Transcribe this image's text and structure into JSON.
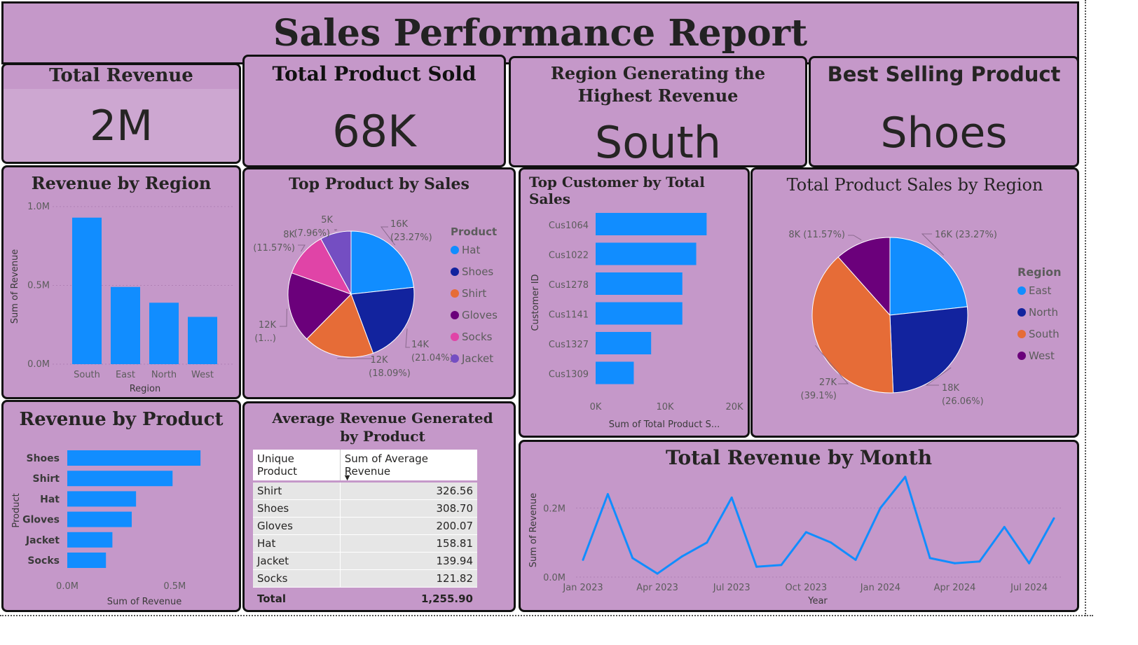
{
  "report_title": "Sales Performance Report",
  "kpis": [
    {
      "label": "Total Revenue",
      "value": "2M"
    },
    {
      "label": "Total Product Sold",
      "value": "68K"
    },
    {
      "label": "Region Generating the Highest Revenue",
      "value": "South"
    },
    {
      "label": "Best Selling Product",
      "value": "Shoes"
    }
  ],
  "colors": {
    "panel_bg": "#c598c9",
    "bar": "#118dff",
    "east": "#118dff",
    "north": "#12239e",
    "south": "#e66c37",
    "west": "#6b007b",
    "socks": "#e044a7",
    "jacket": "#744ec2"
  },
  "chart_data": [
    {
      "id": "revenue_by_region",
      "type": "bar",
      "title": "Revenue by Region",
      "xlabel": "Region",
      "ylabel": "Sum of Revenue",
      "categories": [
        "South",
        "East",
        "North",
        "West"
      ],
      "values": [
        0.93,
        0.49,
        0.39,
        0.3
      ],
      "ylim": [
        0,
        1.0
      ],
      "ticks": [
        "0.0M",
        "0.5M",
        "1.0M"
      ],
      "tick_values": [
        0,
        0.5,
        1.0
      ],
      "grid": true
    },
    {
      "id": "top_product_by_sales",
      "type": "pie",
      "title": "Top Product by Sales",
      "legend_title": "Product",
      "legend_position": "right",
      "slices": [
        {
          "name": "Hat",
          "value": 23.27,
          "label_a": "16K",
          "label_b": "(23.27%)",
          "color": "#118dff"
        },
        {
          "name": "Shoes",
          "value": 21.04,
          "label_a": "14K",
          "label_b": "(21.04%)",
          "color": "#12239e"
        },
        {
          "name": "Shirt",
          "value": 18.09,
          "label_a": "12K",
          "label_b": "(18.09%)",
          "color": "#e66c37"
        },
        {
          "name": "Gloves",
          "value": 18.07,
          "label_a": "12K",
          "label_b": "(1...)",
          "color": "#6b007b"
        },
        {
          "name": "Socks",
          "value": 11.57,
          "label_a": "8K",
          "label_b": "(11.57%)",
          "color": "#e044a7"
        },
        {
          "name": "Jacket",
          "value": 7.96,
          "label_a": "5K",
          "label_b": "(7.96%)",
          "color": "#744ec2"
        }
      ]
    },
    {
      "id": "top_customer_by_total_sales",
      "type": "bar",
      "orientation": "horizontal",
      "title": "Top Customer by Total Sales",
      "xlabel": "Sum of Total Product S...",
      "ylabel": "Customer ID",
      "categories": [
        "Cus1064",
        "Cus1022",
        "Cus1278",
        "Cus1141",
        "Cus1327",
        "Cus1309"
      ],
      "values": [
        16000,
        14500,
        12500,
        12500,
        8000,
        5500
      ],
      "xlim": [
        0,
        20000
      ],
      "ticks": [
        "0K",
        "10K",
        "20K"
      ],
      "tick_values": [
        0,
        10000,
        20000
      ]
    },
    {
      "id": "total_product_sales_by_region",
      "type": "pie",
      "title": "Total Product Sales by Region",
      "legend_title": "Region",
      "legend_position": "right",
      "slices": [
        {
          "name": "East",
          "value": 23.27,
          "label_a": "16K (23.27%)",
          "label_b": "",
          "color": "#118dff"
        },
        {
          "name": "North",
          "value": 26.06,
          "label_a": "18K",
          "label_b": "(26.06%)",
          "color": "#12239e"
        },
        {
          "name": "South",
          "value": 39.1,
          "label_a": "27K",
          "label_b": "(39.1%)",
          "color": "#e66c37"
        },
        {
          "name": "West",
          "value": 11.57,
          "label_a": "8K (11.57%)",
          "label_b": "",
          "color": "#6b007b"
        }
      ]
    },
    {
      "id": "revenue_by_product",
      "type": "bar",
      "orientation": "horizontal",
      "title": "Revenue by Product",
      "xlabel": "Sum of Revenue",
      "ylabel": "Product",
      "categories": [
        "Shoes",
        "Shirt",
        "Hat",
        "Gloves",
        "Jacket",
        "Socks"
      ],
      "values": [
        0.62,
        0.49,
        0.32,
        0.3,
        0.21,
        0.18
      ],
      "xlim": [
        0,
        0.75
      ],
      "ticks": [
        "0.0M",
        "0.5M"
      ],
      "tick_values": [
        0,
        0.5
      ]
    },
    {
      "id": "average_revenue_by_product",
      "type": "table",
      "title": "Average Revenue Generated by Product",
      "columns": [
        "Unique Product",
        "Sum of Average Revenue"
      ],
      "rows": [
        [
          "Shirt",
          "326.56"
        ],
        [
          "Shoes",
          "308.70"
        ],
        [
          "Gloves",
          "200.07"
        ],
        [
          "Hat",
          "158.81"
        ],
        [
          "Jacket",
          "139.94"
        ],
        [
          "Socks",
          "121.82"
        ]
      ],
      "total": [
        "Total",
        "1,255.90"
      ]
    },
    {
      "id": "total_revenue_by_month",
      "type": "line",
      "title": "Total Revenue by Month",
      "xlabel": "Year",
      "ylabel": "Sum of Revenue",
      "x": [
        "2023-01",
        "2023-02",
        "2023-03",
        "2023-04",
        "2023-05",
        "2023-06",
        "2023-07",
        "2023-08",
        "2023-09",
        "2023-10",
        "2023-11",
        "2023-12",
        "2024-01",
        "2024-02",
        "2024-03",
        "2024-04",
        "2024-05",
        "2024-06",
        "2024-07",
        "2024-08"
      ],
      "y": [
        0.05,
        0.24,
        0.055,
        0.01,
        0.06,
        0.1,
        0.23,
        0.03,
        0.035,
        0.13,
        0.1,
        0.05,
        0.2,
        0.29,
        0.055,
        0.04,
        0.045,
        0.145,
        0.04,
        0.17
      ],
      "ylim": [
        0,
        0.3
      ],
      "yticks": [
        "0.0M",
        "0.2M"
      ],
      "ytick_values": [
        0,
        0.2
      ],
      "xticks": [
        "Jan 2023",
        "Apr 2023",
        "Jul 2023",
        "Oct 2023",
        "Jan 2024",
        "Apr 2024",
        "Jul 2024"
      ],
      "xtick_index": [
        0,
        3,
        6,
        9,
        12,
        15,
        18
      ]
    }
  ]
}
